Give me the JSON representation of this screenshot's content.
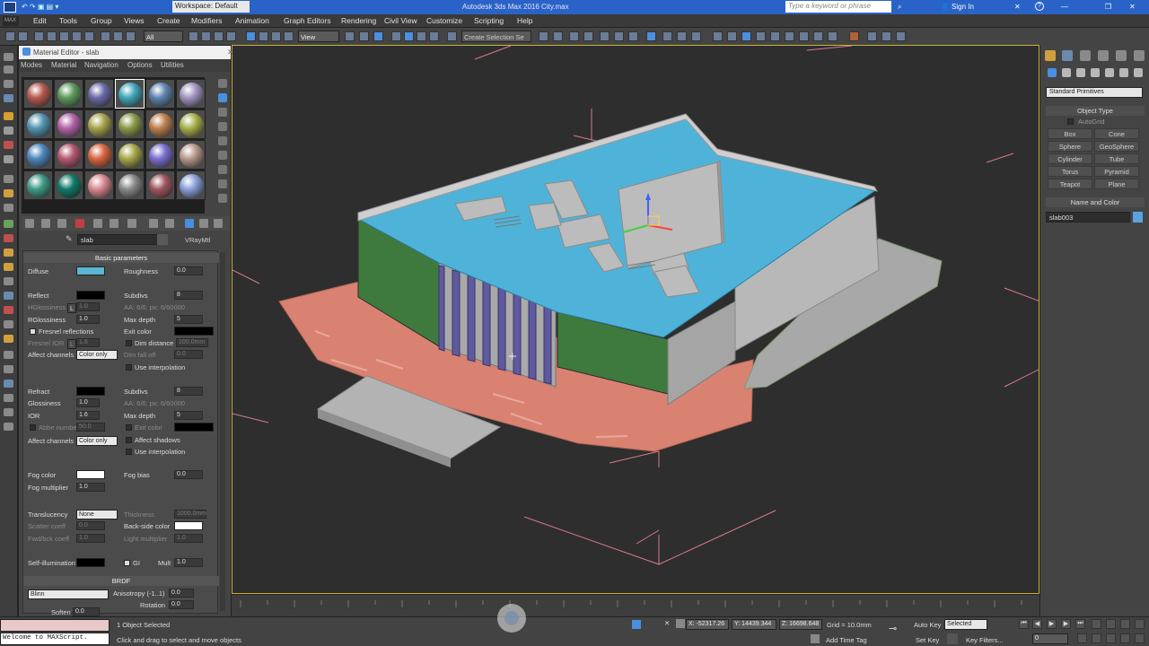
{
  "titlebar": {
    "workspace": "Workspace: Default",
    "title": "Autodesk 3ds Max 2016    City.max",
    "search_placeholder": "Type a keyword or phrase",
    "sign_in": "Sign In"
  },
  "menu": [
    "Edit",
    "Tools",
    "Group",
    "Views",
    "Create",
    "Modifiers",
    "Animation",
    "Graph Editors",
    "Rendering",
    "Civil View",
    "Customize",
    "Scripting",
    "Help"
  ],
  "toolbar": {
    "filter": "All",
    "view": "View",
    "selection_set": "Create Selection Se"
  },
  "material_editor": {
    "title": "Material Editor - slab",
    "menu": [
      "Modes",
      "Material",
      "Navigation",
      "Options",
      "Utilities"
    ],
    "slots": [
      "#b85a4e",
      "#5f9a5c",
      "#6a6aa8",
      "#3fa6b9",
      "#5f86b1",
      "#a295c2",
      "#5596b2",
      "#b364a9",
      "#a8a44e",
      "#8a9a4c",
      "#bd8150",
      "#a8b24a",
      "#4f86bf",
      "#b55872",
      "#d8653f",
      "#a8a84c",
      "#7b6fd0",
      "#b89a8c",
      "#3f9a88",
      "#0f7a68",
      "#d88890",
      "#8a8a8a",
      "#a05660",
      "#8aa0d8"
    ],
    "material_name": "slab",
    "material_type": "VRayMtl",
    "basic": {
      "header": "Basic parameters",
      "diffuse": "Diffuse",
      "diffuse_color": "#5bb6d3",
      "roughness": "Roughness",
      "roughness_val": "0.0",
      "reflect": "Reflect",
      "subdivs": "Subdivs",
      "subdivs_val": "8",
      "hglossiness": "HGlossiness",
      "hgloss_L": "L",
      "hgloss_val": "1.0",
      "aa": "AA: 6/6; px: 6/60000",
      "rglossiness": "RGlossiness",
      "rgloss_val": "1.0",
      "max_depth": "Max depth",
      "max_depth_val": "5",
      "fresnel": "Fresnel reflections",
      "exit_color": "Exit color",
      "fresnel_ior": "Fresnel IOR",
      "fresnel_L": "L",
      "fresnel_val": "1.6",
      "dim_distance": "Dim distance",
      "dim_distance_val": "100.0mm",
      "affect_channels": "Affect channels",
      "affect_val": "Color only",
      "dim_falloff": "Dim fall off",
      "dim_falloff_val": "0.0",
      "use_interp": "Use interpolation",
      "refract": "Refract",
      "r_subdivs": "Subdivs",
      "r_subdivs_val": "8",
      "glossiness": "Glossiness",
      "gloss_val": "1.0",
      "r_aa": "AA: 6/6; px: 6/60000",
      "ior": "IOR",
      "ior_val": "1.6",
      "r_max_depth": "Max depth",
      "r_max_depth_val": "5",
      "abbe": "Abbe number",
      "abbe_val": "50.0",
      "r_exit_color": "Exit color",
      "affect_shadows": "Affect shadows",
      "r_affect_channels": "Affect channels",
      "r_affect_val": "Color only",
      "r_use_interp": "Use interpolation",
      "fog_color": "Fog color",
      "fog_bias": "Fog bias",
      "fog_bias_val": "0.0",
      "fog_mult": "Fog multiplier",
      "fog_mult_val": "1.0",
      "translucency": "Translucency",
      "transl_val": "None",
      "thickness": "Thickness",
      "thickness_val": "1000.0mm",
      "scatter": "Scatter coeff",
      "scatter_val": "0.0",
      "backside": "Back-side color",
      "fwdbck": "Fwd/bck coeff",
      "fwdbck_val": "1.0",
      "light_mult": "Light multiplier",
      "light_mult_val": "1.0",
      "self_illum": "Self-illumination",
      "gi": "GI",
      "mult": "Mult",
      "mult_val": "1.0"
    },
    "brdf": {
      "header": "BRDF",
      "type": "Blinn",
      "anisotropy": "Anisotropy (-1..1)",
      "aniso_val": "0.0",
      "rotation": "Rotation",
      "rot_val": "0.0",
      "soften": "Soften",
      "soften_val": "0.0"
    }
  },
  "command_panel": {
    "primitives": "Standard Primitives",
    "object_type": "Object Type",
    "autogrid": "AutoGrid",
    "buttons": [
      "Box",
      "Cone",
      "Sphere",
      "GeoSphere",
      "Cylinder",
      "Tube",
      "Torus",
      "Pyramid",
      "Teapot",
      "Plane"
    ],
    "name_color": "Name and Color",
    "object_name": "slab003",
    "object_color": "#5aa3e0"
  },
  "status": {
    "selected": "1 Object Selected",
    "prompt": "Click and drag to select and move objects",
    "maxscript": "Welcome to MAXScript.",
    "x": "X: -52317.26",
    "y": "Y: 14439.344",
    "z": "Z: 16698.648",
    "grid": "Grid = 10.0mm",
    "auto_key": "Auto Key",
    "selected_dd": "Selected",
    "set_key": "Set Key",
    "key_filters": "Key Filters...",
    "add_time_tag": "Add Time Tag",
    "frame": "0"
  },
  "colors": {
    "titlebar": "#2a63c8",
    "viewport_border": "#c9b13a",
    "roof": "#4fb3d9",
    "plaza": "#d98272",
    "glass_green": "#3e7a3e",
    "fins": "#6b65a8"
  }
}
